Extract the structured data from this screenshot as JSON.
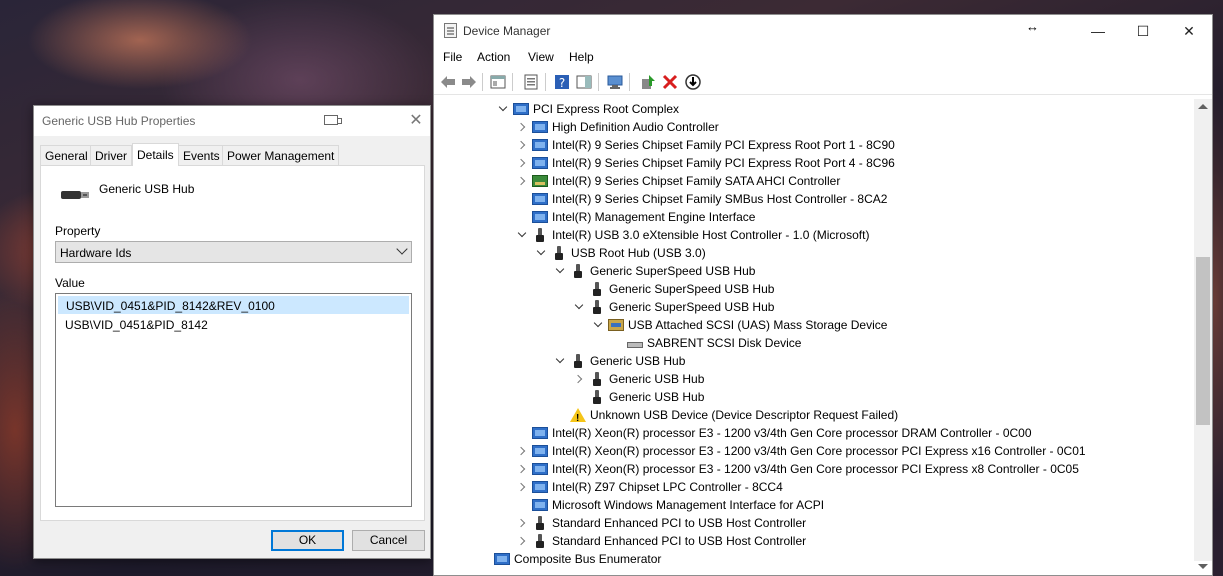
{
  "properties_dialog": {
    "title": "Generic USB Hub Properties",
    "tabs": [
      "General",
      "Driver",
      "Details",
      "Events",
      "Power Management"
    ],
    "active_tab": "Details",
    "device_name": "Generic USB Hub",
    "property_label": "Property",
    "property_value": "Hardware Ids",
    "value_label": "Value",
    "values": [
      "USB\\VID_0451&PID_8142&REV_0100",
      "USB\\VID_0451&PID_8142"
    ],
    "ok_label": "OK",
    "cancel_label": "Cancel"
  },
  "device_manager": {
    "title": "Device Manager",
    "menus": [
      "File",
      "Action",
      "View",
      "Help"
    ],
    "window_controls": {
      "minimize": "—",
      "maximize": "☐",
      "close": "✕"
    },
    "tree": [
      {
        "label": "PCI Express Root Complex",
        "level": 0,
        "expander": "open",
        "icon": "pci-icon"
      },
      {
        "label": "High Definition Audio Controller",
        "level": 1,
        "expander": "closed",
        "icon": "pci-icon"
      },
      {
        "label": "Intel(R) 9 Series Chipset Family PCI Express Root Port 1 - 8C90",
        "level": 1,
        "expander": "closed",
        "icon": "pci-icon"
      },
      {
        "label": "Intel(R) 9 Series Chipset Family PCI Express Root Port 4 - 8C96",
        "level": 1,
        "expander": "closed",
        "icon": "pci-icon"
      },
      {
        "label": "Intel(R) 9 Series Chipset Family SATA AHCI Controller",
        "level": 1,
        "expander": "closed",
        "icon": "sata-icon"
      },
      {
        "label": "Intel(R) 9 Series Chipset Family SMBus Host Controller - 8CA2",
        "level": 1,
        "expander": "none",
        "icon": "pci-icon"
      },
      {
        "label": "Intel(R) Management Engine Interface",
        "level": 1,
        "expander": "none",
        "icon": "pci-icon"
      },
      {
        "label": "Intel(R) USB 3.0 eXtensible Host Controller - 1.0 (Microsoft)",
        "level": 1,
        "expander": "open",
        "icon": "usb-icon"
      },
      {
        "label": "USB Root Hub (USB 3.0)",
        "level": 2,
        "expander": "open",
        "icon": "usb-icon"
      },
      {
        "label": "Generic SuperSpeed USB Hub",
        "level": 3,
        "expander": "open",
        "icon": "usb-icon"
      },
      {
        "label": "Generic SuperSpeed USB Hub",
        "level": 4,
        "expander": "none",
        "icon": "usb-icon"
      },
      {
        "label": "Generic SuperSpeed USB Hub",
        "level": 4,
        "expander": "open",
        "icon": "usb-icon"
      },
      {
        "label": "USB Attached SCSI (UAS) Mass Storage Device",
        "level": 5,
        "expander": "open",
        "icon": "scsi-icon"
      },
      {
        "label": "SABRENT  SCSI Disk Device",
        "level": 6,
        "expander": "none",
        "icon": "disk-icon"
      },
      {
        "label": "Generic USB Hub",
        "level": 3,
        "expander": "open",
        "icon": "usb-icon"
      },
      {
        "label": "Generic USB Hub",
        "level": 4,
        "expander": "closed",
        "icon": "usb-icon"
      },
      {
        "label": "Generic USB Hub",
        "level": 4,
        "expander": "none",
        "icon": "usb-icon"
      },
      {
        "label": "Unknown USB Device (Device Descriptor Request Failed)",
        "level": 3,
        "expander": "none",
        "icon": "warning-icon"
      },
      {
        "label": "Intel(R) Xeon(R) processor E3 - 1200 v3/4th Gen Core processor DRAM Controller - 0C00",
        "level": 1,
        "expander": "none",
        "icon": "pci-icon"
      },
      {
        "label": "Intel(R) Xeon(R) processor E3 - 1200 v3/4th Gen Core processor PCI Express x16 Controller - 0C01",
        "level": 1,
        "expander": "closed",
        "icon": "pci-icon"
      },
      {
        "label": "Intel(R) Xeon(R) processor E3 - 1200 v3/4th Gen Core processor PCI Express x8 Controller - 0C05",
        "level": 1,
        "expander": "closed",
        "icon": "pci-icon"
      },
      {
        "label": "Intel(R) Z97 Chipset LPC Controller - 8CC4",
        "level": 1,
        "expander": "closed",
        "icon": "pci-icon"
      },
      {
        "label": "Microsoft Windows Management Interface for ACPI",
        "level": 1,
        "expander": "none",
        "icon": "pci-icon"
      },
      {
        "label": "Standard Enhanced PCI to USB Host Controller",
        "level": 1,
        "expander": "closed",
        "icon": "usb-icon"
      },
      {
        "label": "Standard Enhanced PCI to USB Host Controller",
        "level": 1,
        "expander": "closed",
        "icon": "usb-icon"
      },
      {
        "label": "Composite Bus Enumerator",
        "level": -1,
        "expander": "none",
        "icon": "pci-icon"
      }
    ]
  }
}
